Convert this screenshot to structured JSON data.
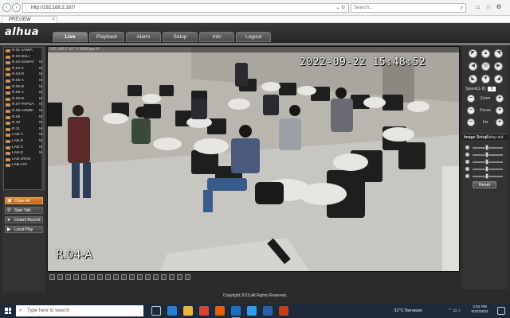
{
  "browser": {
    "address": "http://192.168.2.167/",
    "search_placeholder": "Search...",
    "tab_label": "PREVIEW"
  },
  "app": {
    "logo": "alhua",
    "nav": [
      "Live",
      "Playback",
      "Alarm",
      "Setup",
      "Info",
      "Logout"
    ],
    "active_nav": "Live",
    "footer": "Copyright 2015,All Rights Reserved."
  },
  "channels": [
    {
      "label": "R.01-JAMIA",
      "m": ""
    },
    {
      "label": "R.02-BALI",
      "m": ""
    },
    {
      "label": "R.03-SUMAT",
      "m": "M"
    },
    {
      "label": "R.04-A",
      "m": "M"
    },
    {
      "label": "R.04-B",
      "m": "M"
    },
    {
      "label": "R.05-A",
      "m": "M"
    },
    {
      "label": "R.05-B",
      "m": "M"
    },
    {
      "label": "R.06-A",
      "m": "M"
    },
    {
      "label": "R.06-B",
      "m": "M"
    },
    {
      "label": "R.07-PAPUA",
      "m": "M"
    },
    {
      "label": "R.08-LOMBI",
      "m": "M"
    },
    {
      "label": "R.09",
      "m": "M"
    },
    {
      "label": "R.10",
      "m": "M"
    },
    {
      "label": "R.11",
      "m": "M"
    },
    {
      "label": "LAB-A",
      "m": "M"
    },
    {
      "label": "LAB-B",
      "m": "M"
    },
    {
      "label": "LAB-C",
      "m": "M"
    },
    {
      "label": "LAB-D",
      "m": "M"
    },
    {
      "label": "LAB-JRSN",
      "m": ""
    },
    {
      "label": "LAB-LPA",
      "m": ""
    }
  ],
  "left_buttons": {
    "close_all": "Close All",
    "start_talk": "Start Talk",
    "instant_record": "Instant Record",
    "local_play": "Local Play"
  },
  "video": {
    "info": "192.168.2.167 4 996Kbps H",
    "timestamp": "2022-09-22 15:48:52",
    "camera_name": "R.04-A"
  },
  "ptz": {
    "speed_label": "Speed(1-8):",
    "speed_value": "5",
    "zoom": "Zoom",
    "focus": "Focus",
    "iris": "Iris",
    "image_setup": "Image Setup",
    "relay_out": "Relay-out",
    "reset": "Reset",
    "sliders": [
      0.45,
      0.45,
      0.45,
      0.45,
      0.45
    ]
  },
  "taskbar": {
    "search_placeholder": "Type here to search",
    "weather": "31°C  Berawan",
    "time": "3:52 PM",
    "date": "9/22/2022"
  },
  "colors": {
    "accent_orange": "#d9792a",
    "header_dark": "#2b2b2b",
    "taskbar": "#1e2a3a"
  }
}
